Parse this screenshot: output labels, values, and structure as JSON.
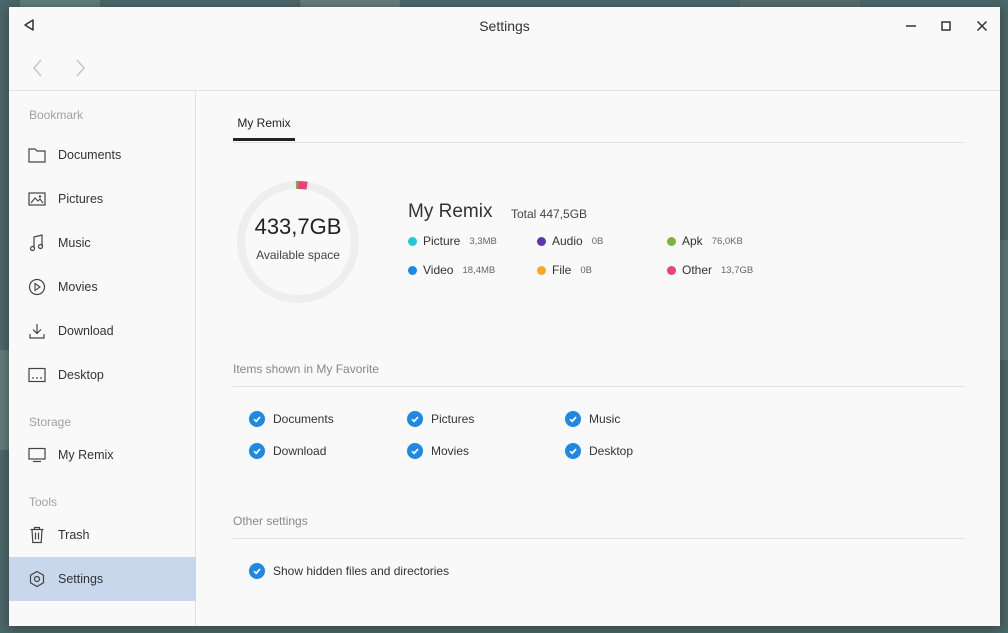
{
  "window": {
    "title": "Settings"
  },
  "sidebar": {
    "sections": [
      {
        "label": "Bookmark"
      },
      {
        "label": "Storage"
      },
      {
        "label": "Tools"
      }
    ],
    "items": [
      {
        "label": "Documents",
        "icon": "folder-icon"
      },
      {
        "label": "Pictures",
        "icon": "image-icon"
      },
      {
        "label": "Music",
        "icon": "music-note-icon"
      },
      {
        "label": "Movies",
        "icon": "play-circle-icon"
      },
      {
        "label": "Download",
        "icon": "download-icon"
      },
      {
        "label": "Desktop",
        "icon": "desktop-icon"
      },
      {
        "label": "My Remix",
        "icon": "monitor-icon"
      },
      {
        "label": "Trash",
        "icon": "trash-icon"
      },
      {
        "label": "Settings",
        "icon": "gear-icon",
        "active": true
      }
    ]
  },
  "main": {
    "tab": "My Remix",
    "storage": {
      "available": "433,7GB",
      "available_label": "Available space",
      "device_name": "My Remix",
      "total": "Total 447,5GB",
      "used_fraction": 0.031,
      "legend": [
        {
          "name": "Picture",
          "size": "3,3MB",
          "color": "#26c6da"
        },
        {
          "name": "Audio",
          "size": "0B",
          "color": "#5e35b1"
        },
        {
          "name": "Apk",
          "size": "76,0KB",
          "color": "#7cb342"
        },
        {
          "name": "Video",
          "size": "18,4MB",
          "color": "#1e88e5"
        },
        {
          "name": "File",
          "size": "0B",
          "color": "#f9a825"
        },
        {
          "name": "Other",
          "size": "13,7GB",
          "color": "#ec407a"
        }
      ]
    },
    "favorites": {
      "title": "Items shown in My Favorite",
      "items": [
        {
          "label": "Documents",
          "checked": true
        },
        {
          "label": "Pictures",
          "checked": true
        },
        {
          "label": "Music",
          "checked": true
        },
        {
          "label": "Download",
          "checked": true
        },
        {
          "label": "Movies",
          "checked": true
        },
        {
          "label": "Desktop",
          "checked": true
        }
      ]
    },
    "other": {
      "title": "Other settings",
      "show_hidden_label": "Show hidden files and directories",
      "show_hidden_checked": true
    }
  },
  "colors": {
    "accent": "#1e88e5",
    "selection": "#c9d7ec"
  }
}
